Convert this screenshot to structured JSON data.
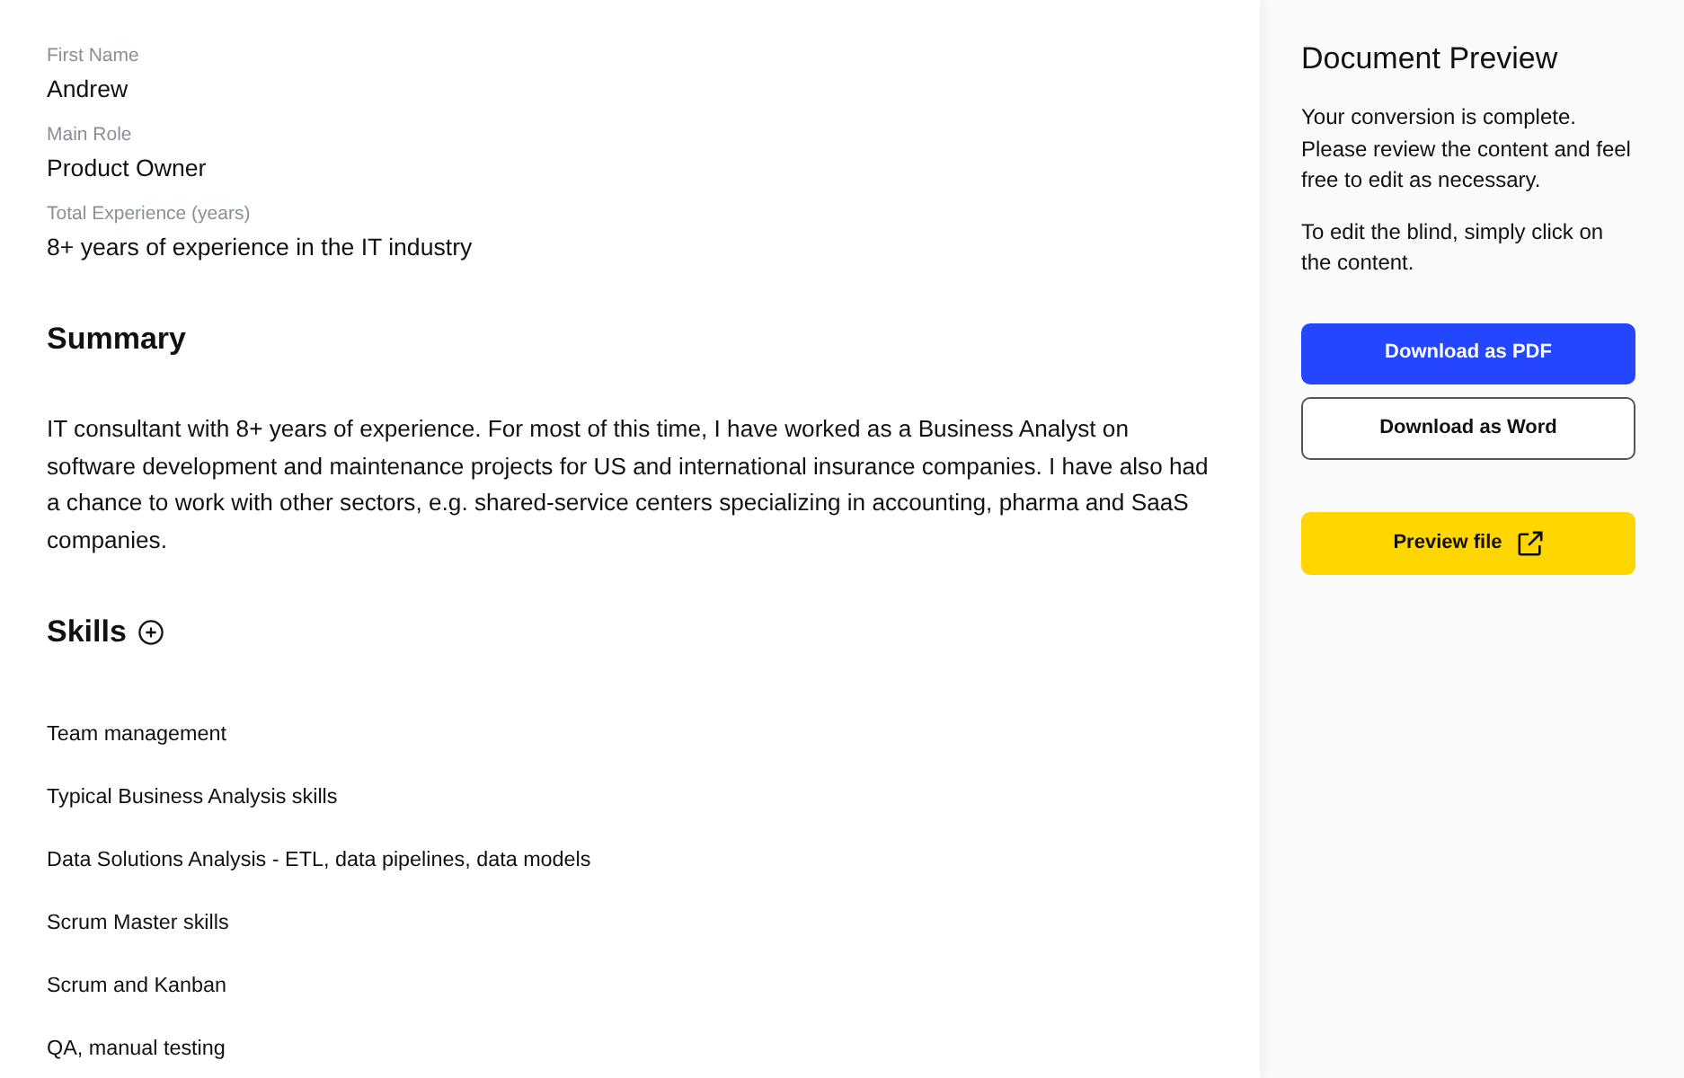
{
  "fields": [
    {
      "label": "First Name",
      "value": "Andrew"
    },
    {
      "label": "Main Role",
      "value": "Product Owner"
    },
    {
      "label": "Total Experience (years)",
      "value": "8+ years of experience in the IT industry"
    }
  ],
  "summary": {
    "heading": "Summary",
    "text": "IT consultant with 8+ years of experience. For most of this time, I have worked as a Business Analyst on software development and maintenance projects for US and international insurance companies. I have also had a chance to work with other sectors, e.g. shared-service centers specializing in accounting, pharma and SaaS companies."
  },
  "skills": {
    "heading": "Skills",
    "items": [
      "Team management",
      "Typical Business Analysis skills",
      "Data Solutions Analysis - ETL, data pipelines, data models",
      "Scrum Master skills",
      "Scrum and Kanban",
      "QA, manual testing"
    ]
  },
  "preview_panel": {
    "title": "Document Preview",
    "paragraphs": [
      "Your conversion is complete. Please review the content and feel free to edit as necessary.",
      "To edit the blind, simply click on the content."
    ],
    "buttons": [
      {
        "label": "Download as PDF",
        "kind": "primary"
      },
      {
        "label": "Download as Word",
        "kind": "outline"
      },
      {
        "label": "Preview file",
        "kind": "accent"
      }
    ]
  }
}
